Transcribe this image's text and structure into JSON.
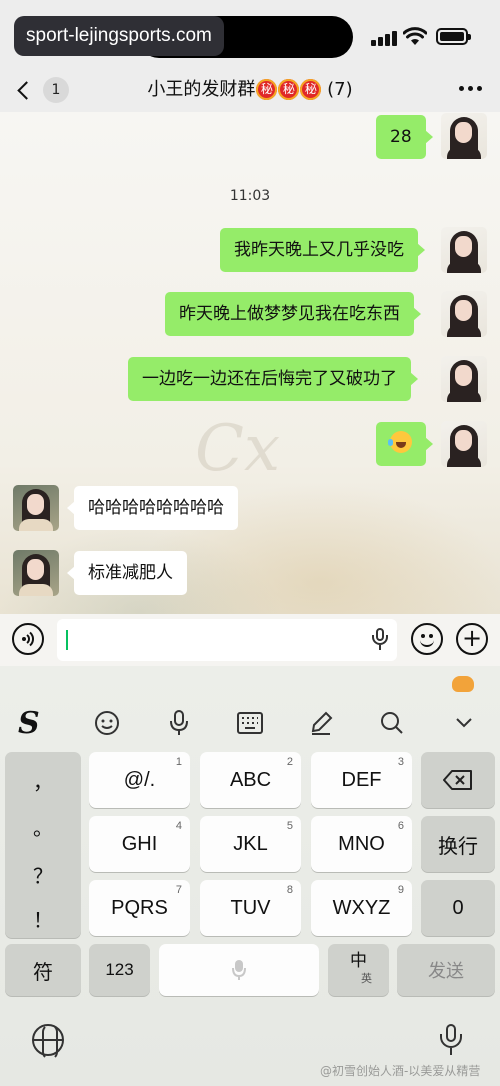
{
  "status_bar": {
    "watermark": "sport-lejingsports.com"
  },
  "title_bar": {
    "unread_count": "1",
    "chat_name": "小王的发财群",
    "secret_badges": [
      "秘",
      "秘",
      "秘"
    ],
    "member_count": "(7)"
  },
  "chat": {
    "background_signature": "Cx",
    "messages": [
      {
        "side": "me",
        "text": "28"
      },
      {
        "type": "time",
        "text": "11:03"
      },
      {
        "side": "me",
        "text": "我昨天晚上又几乎没吃"
      },
      {
        "side": "me",
        "text": "昨天晚上做梦梦见我在吃东西"
      },
      {
        "side": "me",
        "text": "一边吃一边还在后悔完了又破功了"
      },
      {
        "side": "me",
        "emoji": "laughing-crying-emoji"
      },
      {
        "side": "them",
        "text": "哈哈哈哈哈哈哈哈"
      },
      {
        "side": "them",
        "text": "标准减肥人"
      }
    ]
  },
  "input_bar": {
    "voice_toggle_icon": "voice-wave-icon",
    "value": "",
    "emoji_icon": "smiley-icon",
    "plus_icon": "plus-icon"
  },
  "keyboard": {
    "toolbar": [
      "sogou-logo-icon",
      "emoji-icon",
      "mic-icon",
      "keyboard-icon",
      "pen-icon",
      "search-icon",
      "chevron-down-icon"
    ],
    "punctuation": [
      "，",
      "。",
      "？",
      "！"
    ],
    "keys": [
      {
        "label": "@/.",
        "num": "1"
      },
      {
        "label": "ABC",
        "num": "2"
      },
      {
        "label": "DEF",
        "num": "3"
      },
      {
        "label": "GHI",
        "num": "4"
      },
      {
        "label": "JKL",
        "num": "5"
      },
      {
        "label": "MNO",
        "num": "6"
      },
      {
        "label": "PQRS",
        "num": "7"
      },
      {
        "label": "TUV",
        "num": "8"
      },
      {
        "label": "WXYZ",
        "num": "9"
      }
    ],
    "newline": "换行",
    "zero": "0",
    "symbols": "符",
    "numbers": "123",
    "lang_top": "中",
    "lang_bottom": "英",
    "send": "发送"
  },
  "footer": {
    "caption": "@初雪创始人酒-以美爱从精营"
  },
  "colors": {
    "my_bubble": "#95ec69",
    "their_bubble": "#ffffff",
    "cursor": "#07c160",
    "secret_badge": "#e02828"
  }
}
